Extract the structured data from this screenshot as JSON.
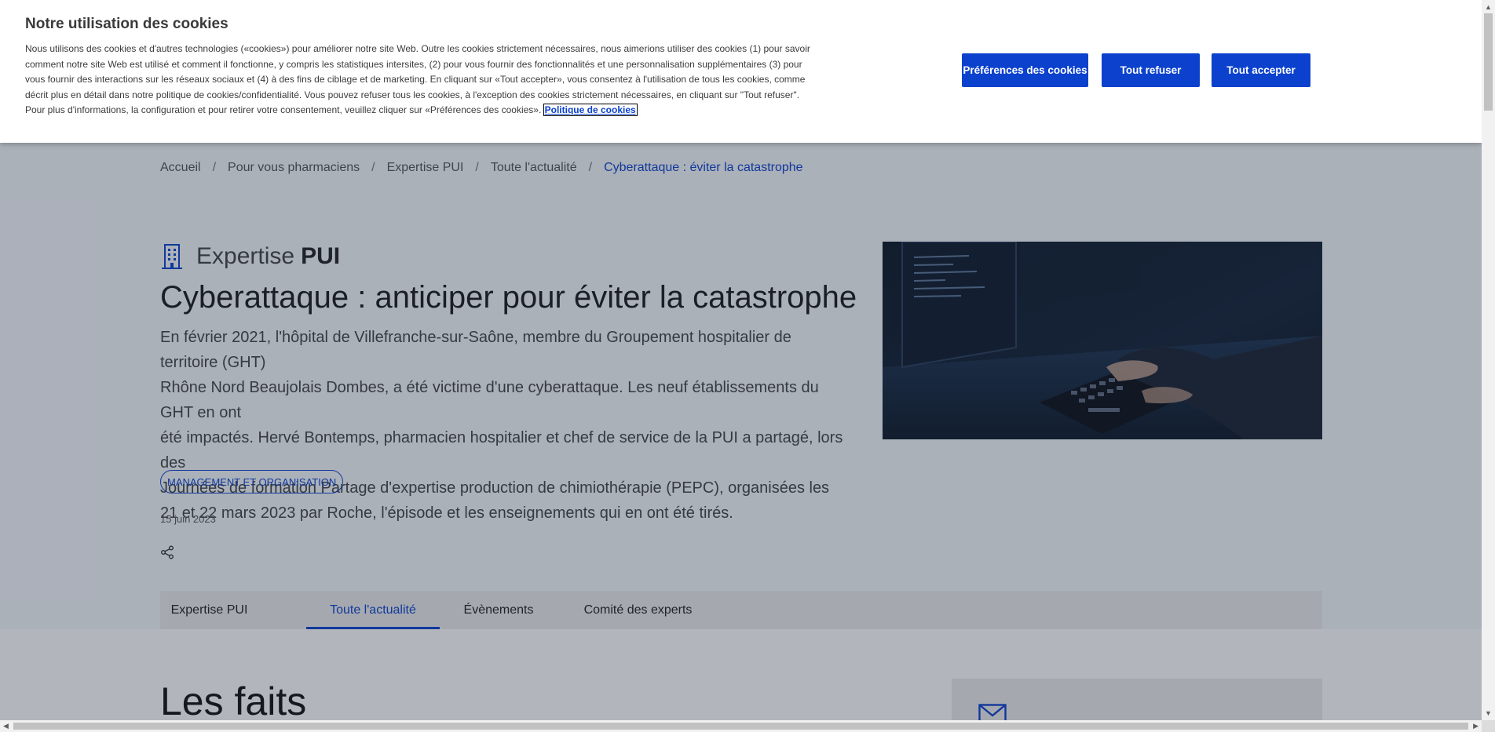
{
  "cookie_banner": {
    "title": "Notre utilisation des cookies",
    "text": "Nous utilisons des cookies et d'autres technologies («cookies») pour améliorer notre site Web. Outre les cookies strictement nécessaires, nous aimerions utiliser des cookies (1) pour savoir comment notre site Web est utilisé et comment il fonctionne, y compris les statistiques intersites, (2) pour vous fournir des fonctionnalités et une personnalisation supplémentaires (3) pour vous fournir des interactions sur les réseaux sociaux et (4) à des fins de ciblage et de marketing. En cliquant sur «Tout accepter», vous consentez à l'utilisation de tous les cookies, comme décrit plus en détail dans notre politique de cookies/confidentialité. Vous pouvez refuser tous les cookies, à l'exception des cookies strictement nécessaires, en cliquant sur \"Tout refuser\". Pour plus d'informations, la configuration et pour retirer votre consentement, veuillez cliquer sur «Préférences des cookies».",
    "policy_link": "Politique de cookies",
    "buttons": {
      "preferences": "Préférences des cookies",
      "refuse_all": "Tout refuser",
      "accept_all": "Tout accepter"
    },
    "accent_color": "#0b41cd"
  },
  "breadcrumb": {
    "separator": "/",
    "items": [
      "Accueil",
      "Pour vous pharmaciens",
      "Expertise PUI",
      "Toute l'actualité"
    ],
    "current": "Cyberattaque : éviter la catastrophe"
  },
  "article": {
    "category_light": "Expertise",
    "category_bold": "PUI",
    "category_icon": "building-icon",
    "title": "Cyberattaque : anticiper pour éviter la catastrophe",
    "lead_lines": [
      "En février 2021, l'hôpital de Villefranche-sur-Saône, membre du Groupement hospitalier de territoire (GHT)",
      "Rhône Nord Beaujolais Dombes, a été victime d'une cyberattaque. Les neuf établissements du GHT en ont",
      "été impactés. Hervé Bontemps, pharmacien hospitalier et chef de service de la PUI a partagé, lors des",
      "Journées de formation Partage d'expertise production de chimiothérapie (PEPC), organisées les",
      "21 et 22 mars 2023 par Roche, l'épisode et les enseignements qui en ont été tirés."
    ],
    "tag": "MANAGEMENT ET ORGANISATION",
    "date": "15 juin 2023",
    "share_icon": "share-icon",
    "image_alt": "hands-typing-keyboard-image"
  },
  "tabs": [
    {
      "label": "Expertise PUI",
      "active": false
    },
    {
      "label": "Toute l'actualité",
      "active": true
    },
    {
      "label": "Évènements",
      "active": false
    },
    {
      "label": "Comité des experts",
      "active": false
    }
  ],
  "section": {
    "title": "Les faits"
  }
}
